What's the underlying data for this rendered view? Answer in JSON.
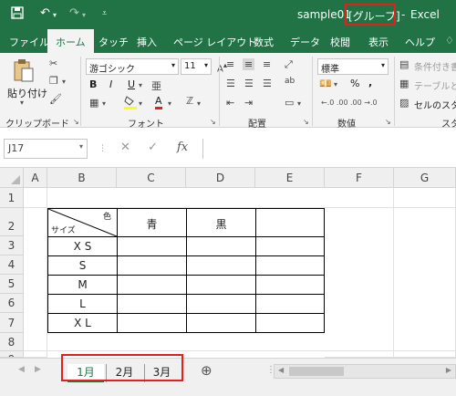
{
  "title_bar": {
    "save_icon": "save-icon",
    "undo_icon": "undo-icon",
    "redo_icon": "redo-icon",
    "customize_icon": "customize-icon",
    "filename": "sample01",
    "group_tag": "[グループ]",
    "separator": "-",
    "app_name": "Excel"
  },
  "ribbon_tabs": [
    "ファイル",
    "ホーム",
    "タッチ",
    "挿入",
    "ページ レイアウト",
    "数式",
    "データ",
    "校閲",
    "表示",
    "ヘルプ"
  ],
  "active_tab": "ホーム",
  "clipboard": {
    "paste": "貼り付け",
    "group_label": "クリップボード"
  },
  "font": {
    "name": "游ゴシック",
    "size": "11",
    "bold": "B",
    "italic": "I",
    "underline": "U",
    "font_color_letter": "A",
    "phonetic": "亜",
    "group_label": "フォント"
  },
  "alignment": {
    "group_label": "配置",
    "wrap_glyph": "ab"
  },
  "number": {
    "format": "標準",
    "percent": "%",
    "comma": ",",
    "group_label": "数値"
  },
  "styles": {
    "conditional": "条件付き書",
    "table": "テーブルとし",
    "cell_styles": "セルのスタイ",
    "group_label": "スタ"
  },
  "formula_bar": {
    "name_box": "J17",
    "cancel": "✕",
    "enter": "✓",
    "fx": "fx",
    "value": ""
  },
  "columns": [
    "A",
    "B",
    "C",
    "D",
    "E",
    "F",
    "G"
  ],
  "rows": [
    "1",
    "2",
    "3",
    "4",
    "5",
    "6",
    "7",
    "8",
    "9"
  ],
  "table": {
    "corner_top": "色",
    "corner_bottom": "サイズ",
    "headers": [
      "青",
      "黒",
      ""
    ],
    "sizes": [
      "X S",
      "S",
      "M",
      "L",
      "X L"
    ]
  },
  "sheets": [
    "1月",
    "2月",
    "3月"
  ],
  "active_sheet": "1月",
  "add_sheet": "⊕"
}
